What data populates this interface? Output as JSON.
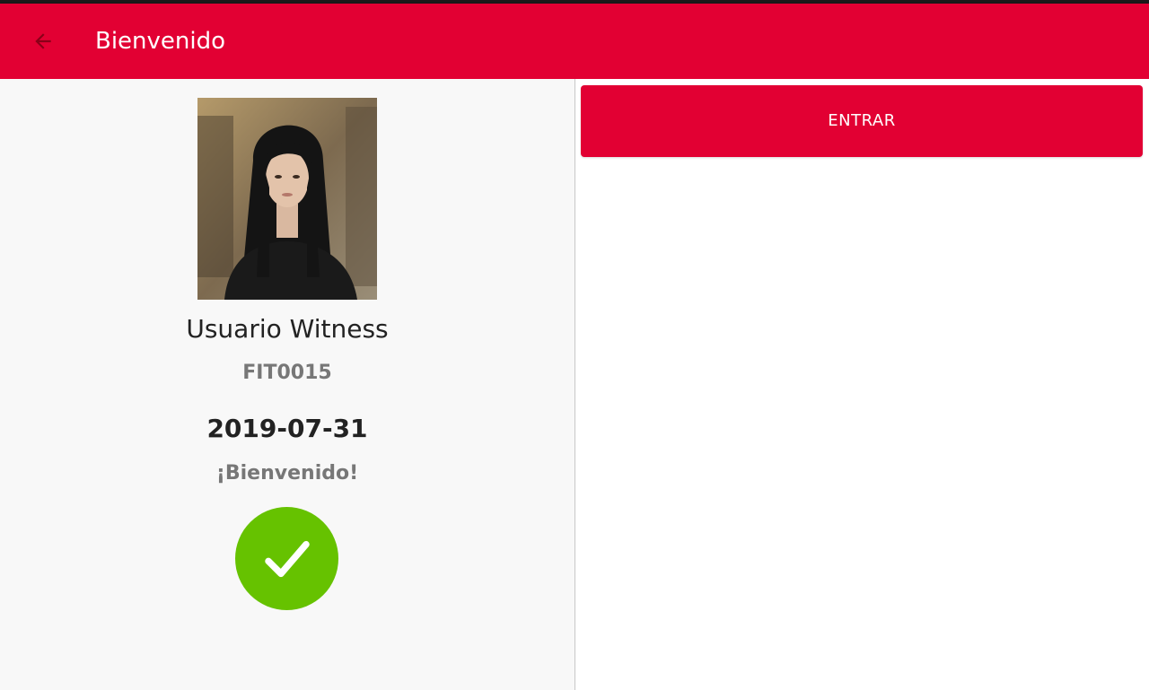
{
  "appbar": {
    "title": "Bienvenido",
    "back_icon": "arrow-left-icon",
    "color": "#e20033"
  },
  "profile": {
    "name": "Usuario Witness",
    "code": "FIT0015",
    "date": "2019-07-31",
    "welcome": "¡Bienvenido!",
    "status_icon": "checkmark-icon",
    "status_color": "#66c200"
  },
  "actions": {
    "enter_label": "ENTRAR"
  }
}
